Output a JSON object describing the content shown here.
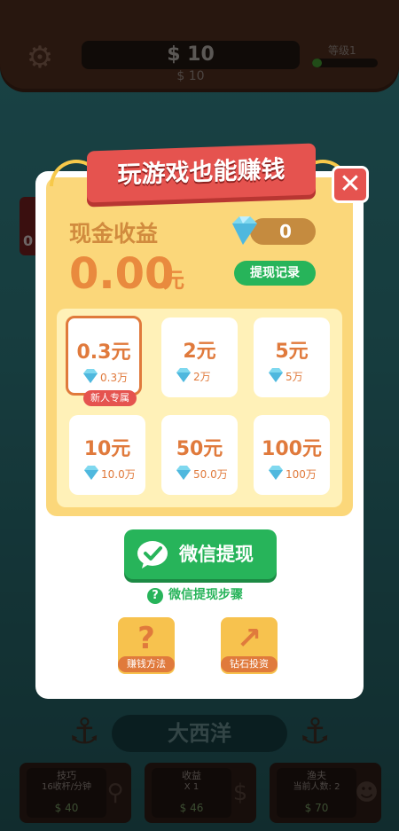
{
  "header": {
    "money": "$ 10",
    "money_sub": "$ 10",
    "level_label": "等级1",
    "level_progress": 0.15,
    "settings_icon": "gear-icon"
  },
  "side_tab_text": "0",
  "modal": {
    "banner_title": "玩游戏也能赚钱",
    "close_icon": "close-icon",
    "cash_label": "现金收益",
    "cash_amount": "0.00",
    "cash_unit": "元",
    "gem_count": "0",
    "record_button": "提现记录",
    "options": [
      {
        "amount": "0.3元",
        "cost": "0.3万",
        "selected": true,
        "tag": "新人专属"
      },
      {
        "amount": "2元",
        "cost": "2万",
        "selected": false
      },
      {
        "amount": "5元",
        "cost": "5万",
        "selected": false
      },
      {
        "amount": "10元",
        "cost": "10.0万",
        "selected": false
      },
      {
        "amount": "50元",
        "cost": "50.0万",
        "selected": false
      },
      {
        "amount": "100元",
        "cost": "100万",
        "selected": false
      }
    ],
    "wechat_button": "微信提现",
    "steps_link": "微信提现步骤",
    "steps_q": "?",
    "tiles": [
      {
        "label": "赚钱方法",
        "icon": "question-icon",
        "glyph": "?"
      },
      {
        "label": "钻石投资",
        "icon": "trend-up-icon",
        "glyph": "↗"
      }
    ]
  },
  "bottom": {
    "ocean": "大西洋",
    "cards": [
      {
        "title": "技巧",
        "sub": "16收杆/分钟",
        "price": "$ 40",
        "icon": "hook-icon"
      },
      {
        "title": "收益",
        "sub": "X 1",
        "price": "$ 46",
        "icon": "money-bag-icon"
      },
      {
        "title": "渔夫",
        "sub": "当前人数: 2",
        "price": "$ 70",
        "icon": "fisherman-icon"
      }
    ]
  },
  "colors": {
    "accent_red": "#e5534f",
    "accent_green": "#27b45a",
    "accent_orange": "#e07a3c",
    "panel_yellow": "#fbd77a"
  }
}
